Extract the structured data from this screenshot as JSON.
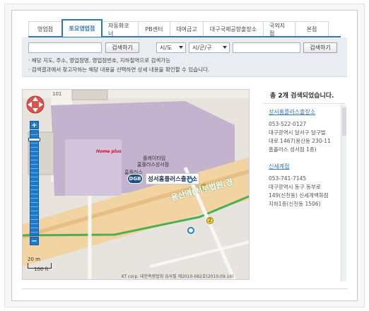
{
  "tabs": [
    {
      "label": "영업점"
    },
    {
      "label": "토요영업점"
    },
    {
      "label": "자동화코너"
    },
    {
      "label": "PB센터"
    },
    {
      "label": "대여금고"
    },
    {
      "label": "대구국제공항출장소"
    },
    {
      "label": "국외지점"
    },
    {
      "label": "본점"
    }
  ],
  "search": {
    "btn1": "검색하기",
    "select1": "시/도",
    "select2": "시/군/구",
    "btn2": "검색하기",
    "hint1": "· 해당 지도, 주소, 영업점명, 영업점번호, 지하철역으로 검색가능",
    "hint2": "· 검색결과에서 찾고자하는 해당 내용을 선택하면 상세 내용을 확인할 수 있습니다."
  },
  "map": {
    "building_no": "101",
    "homeplus": "Home plus",
    "tower_label_1": "플레이타임",
    "tower_label_2": "홈플러스성서점",
    "homeplus_label": "홈플러스",
    "dgb": "DGB",
    "branch_label": "성서홈플러스출장소",
    "station": "용산역(서부법원.경",
    "scale_small": "20 m",
    "scale_big": "100 ft",
    "copyright": "KT corp. 대한측량협회 심사필 제2010-082호(2010.09.16)",
    "marker1": "1",
    "marker2": "2"
  },
  "results": {
    "title_prefix": "총 ",
    "count": "2개",
    "title_suffix": " 검색되었습니다.",
    "items": [
      {
        "name": "성서홈플러스출장소",
        "phone": "053-522-0127",
        "addr1": "대구광역시 달서구 달구벌",
        "addr2": "대로 1467(용산동 230-11",
        "addr3": "홈플러스 성서점 1층)"
      },
      {
        "name": "신세계점",
        "phone": "053-741-7145",
        "addr1": "대구광역시 동구 동부로",
        "addr2": "149(신천동) 신세계백화점",
        "addr3": "지하1층(신천동 1506)"
      }
    ]
  },
  "colors": {
    "accent": "#2f78b8",
    "road": "#f3d9a8",
    "zone": "#b9a9c6",
    "green_road": "#5cc27a"
  }
}
